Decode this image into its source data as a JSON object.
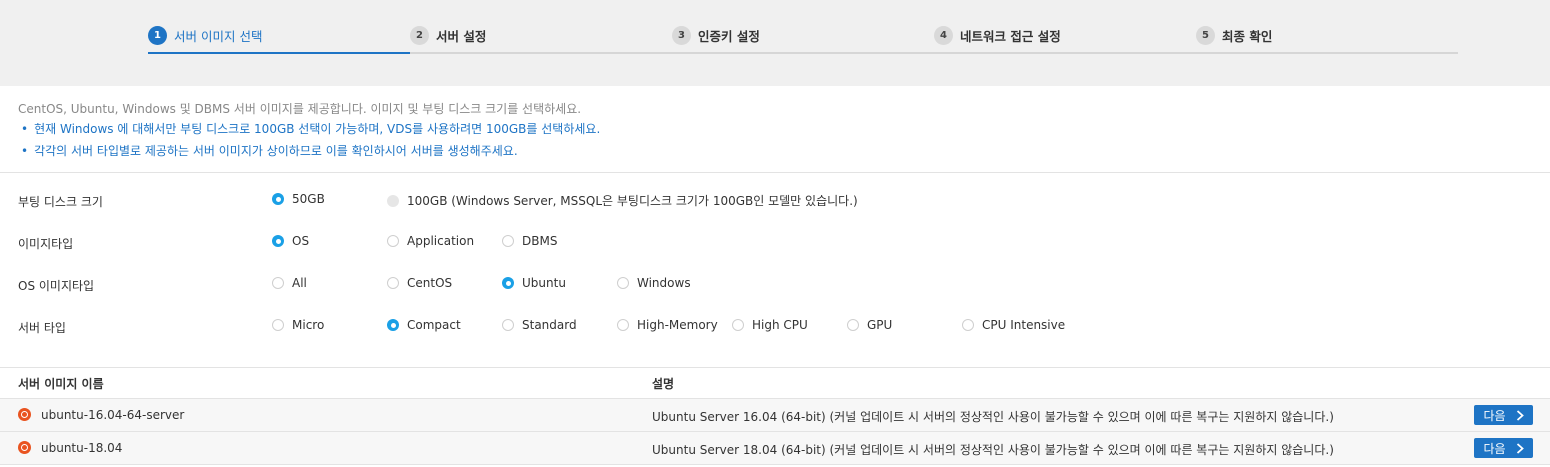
{
  "steps": [
    {
      "num": "1",
      "label": "서버 이미지 선택",
      "active": true
    },
    {
      "num": "2",
      "label": "서버 설정"
    },
    {
      "num": "3",
      "label": "인증키 설정"
    },
    {
      "num": "4",
      "label": "네트워크 접근 설정"
    },
    {
      "num": "5",
      "label": "최종 확인"
    }
  ],
  "info": {
    "main": "CentOS, Ubuntu, Windows 및 DBMS 서버 이미지를 제공합니다. 이미지 및 부팅 디스크 크기를 선택하세요.",
    "bullets": [
      "현재 Windows 에 대해서만 부팅 디스크로 100GB 선택이 가능하며, VDS를 사용하려면 100GB를 선택하세요.",
      "각각의 서버 타입별로 제공하는 서버 이미지가 상이하므로 이를 확인하시어 서버를 생성해주세요."
    ]
  },
  "options": {
    "boot_disk": {
      "label": "부팅 디스크 크기",
      "choices": [
        "50GB",
        "100GB (Windows Server, MSSQL은 부팅디스크 크기가 100GB인 모델만 있습니다.)"
      ]
    },
    "image_type": {
      "label": "이미지타입",
      "choices": [
        "OS",
        "Application",
        "DBMS"
      ]
    },
    "os_image_type": {
      "label": "OS 이미지타입",
      "choices": [
        "All",
        "CentOS",
        "Ubuntu",
        "Windows"
      ]
    },
    "server_type": {
      "label": "서버 타입",
      "choices": [
        "Micro",
        "Compact",
        "Standard",
        "High-Memory",
        "High CPU",
        "GPU",
        "CPU Intensive"
      ]
    }
  },
  "table": {
    "headers": [
      "서버 이미지 이름",
      "설명"
    ],
    "rows": [
      {
        "name": "ubuntu-16.04-64-server",
        "desc": "Ubuntu Server 16.04 (64-bit) (커널 업데이트 시 서버의 정상적인 사용이 불가능할 수 있으며 이에 따른 복구는 지원하지 않습니다.)",
        "button": "다음"
      },
      {
        "name": "ubuntu-18.04",
        "desc": "Ubuntu Server 18.04 (64-bit) (커널 업데이트 시 서버의 정상적인 사용이 불가능할 수 있으며 이에 따른 복구는 지원하지 않습니다.)",
        "button": "다음"
      }
    ]
  },
  "colors": {
    "accent": "#1e74c5",
    "radio_on": "#1aa0e6",
    "os_icon": "#e95420"
  },
  "icons": {
    "row_icon": "ubuntu-icon",
    "next_icon": "chevron-right-icon"
  }
}
